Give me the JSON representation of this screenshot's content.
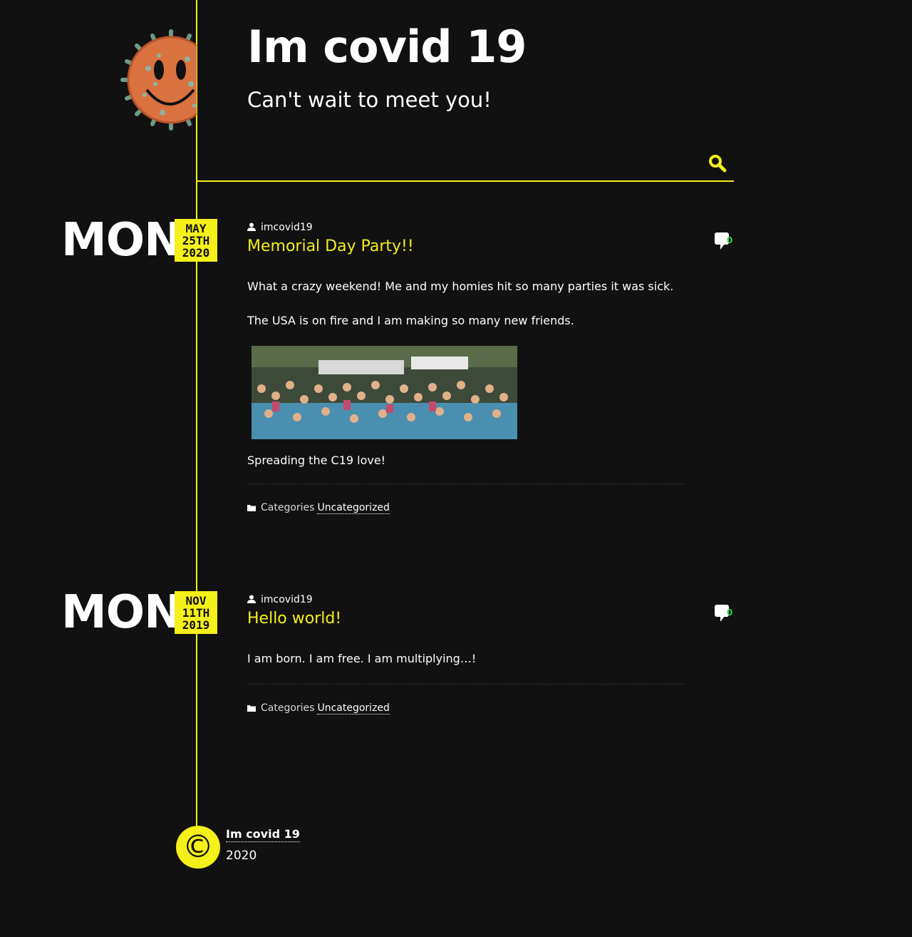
{
  "site": {
    "title": "Im covid 19",
    "tagline": "Can't wait to meet you!"
  },
  "search": {
    "placeholder": "",
    "icon": "search-icon"
  },
  "posts": [
    {
      "day": "MON",
      "month": "MAY",
      "date": "25TH",
      "year": "2020",
      "author": "imcovid19",
      "title": "Memorial Day Party!!",
      "comment_count": "0",
      "paragraphs": [
        "What a crazy weekend! Me and my homies hit so many parties it was sick.",
        "The USA is on fire and I am making so many new friends.",
        "Spreading the C19 love!"
      ],
      "categories_label": "Categories",
      "category": "Uncategorized"
    },
    {
      "day": "MON",
      "month": "NOV",
      "date": "11TH",
      "year": "2019",
      "author": "imcovid19",
      "title": "Hello world!",
      "comment_count": "0",
      "paragraphs": [
        "I am born. I am free. I am multiplying…!"
      ],
      "categories_label": "Categories",
      "category": "Uncategorized"
    }
  ],
  "footer": {
    "copyright_symbol": "©",
    "site_link": "Im covid 19",
    "year": "2020"
  },
  "colors": {
    "background": "#111111",
    "accent": "#f5ef1a",
    "text": "#ffffff",
    "comment_count": "#2bd24c"
  }
}
